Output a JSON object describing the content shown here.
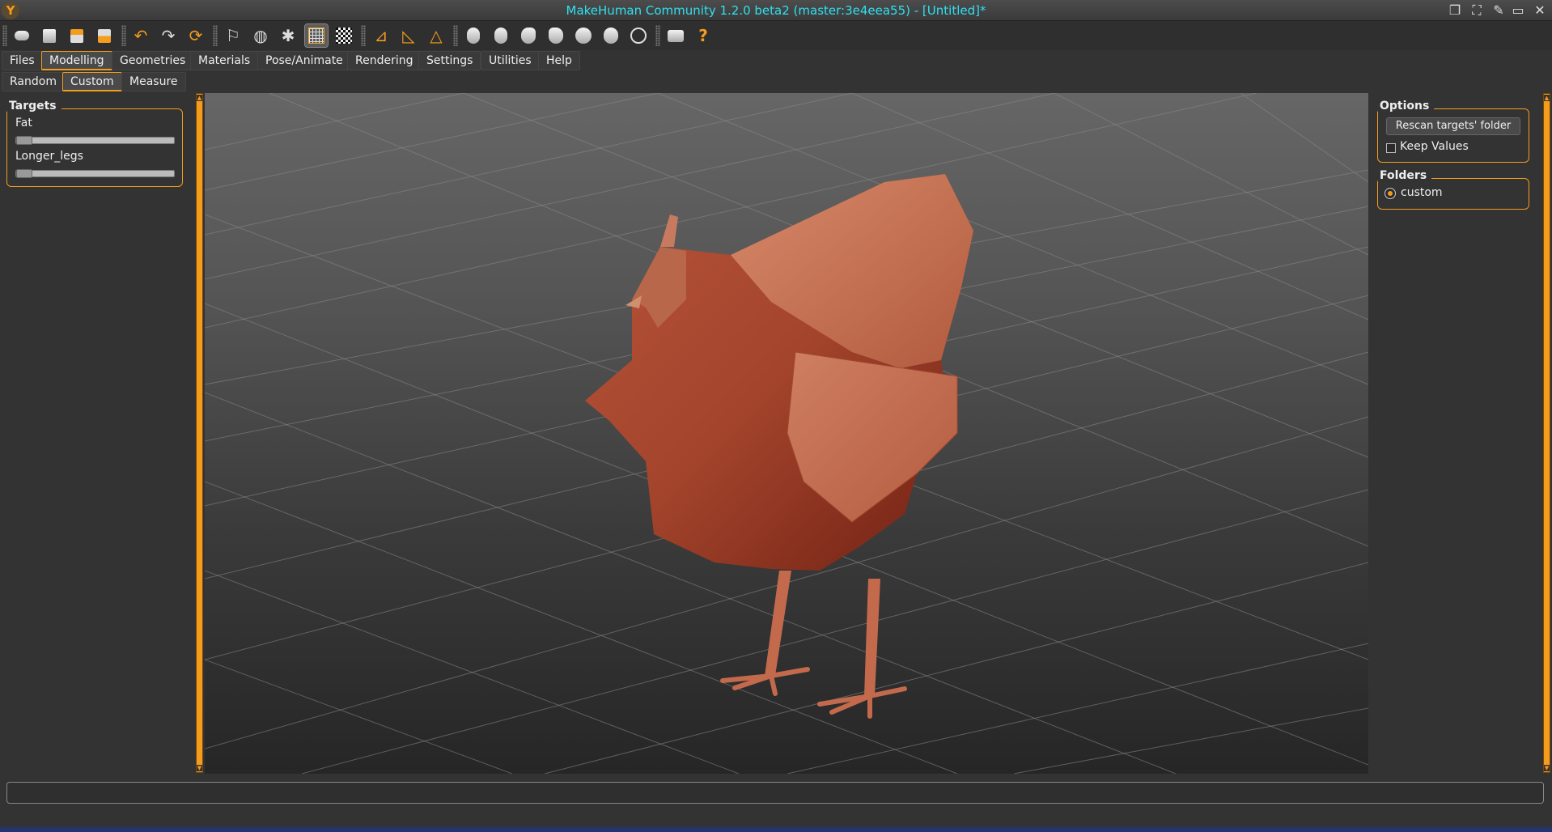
{
  "window": {
    "title": "MakeHuman Community 1.2.0 beta2 (master:3e4eea55) - [Untitled]*"
  },
  "menu_tabs": [
    "Files",
    "Modelling",
    "Geometries",
    "Materials",
    "Pose/Animate",
    "Rendering",
    "Settings",
    "Utilities",
    "Help"
  ],
  "active_menu_tab": "Modelling",
  "sub_tabs": [
    "Random",
    "Custom",
    "Measure"
  ],
  "active_sub_tab": "Custom",
  "toolbar_icons": [
    "new-icon",
    "save-icon",
    "load-icon",
    "export-icon",
    "undo-icon",
    "redo-icon",
    "reset-icon",
    "pose-icon",
    "wireframe-icon",
    "skeleton-icon",
    "grid-icon",
    "checker-icon",
    "symmetry-right-icon",
    "symmetry-left-icon",
    "symmetry-icon",
    "front-view-icon",
    "back-view-icon",
    "left-view-icon",
    "right-view-icon",
    "top-view-icon",
    "bottom-view-icon",
    "reset-camera-icon",
    "screenshot-icon",
    "help-icon"
  ],
  "targets_panel": {
    "title": "Targets",
    "sliders": [
      {
        "label": "Fat",
        "value": 0.0
      },
      {
        "label": "Longer_legs",
        "value": 0.0
      }
    ]
  },
  "options_panel": {
    "title": "Options",
    "rescan_label": "Rescan targets' folder",
    "keep_values_label": "Keep Values",
    "keep_values_checked": false
  },
  "folders_panel": {
    "title": "Folders",
    "items": [
      {
        "label": "custom",
        "selected": true
      }
    ]
  },
  "colors": {
    "accent": "#f39c1e",
    "title_text": "#2ee0f0",
    "model": "#b8553a"
  },
  "status_text": ""
}
